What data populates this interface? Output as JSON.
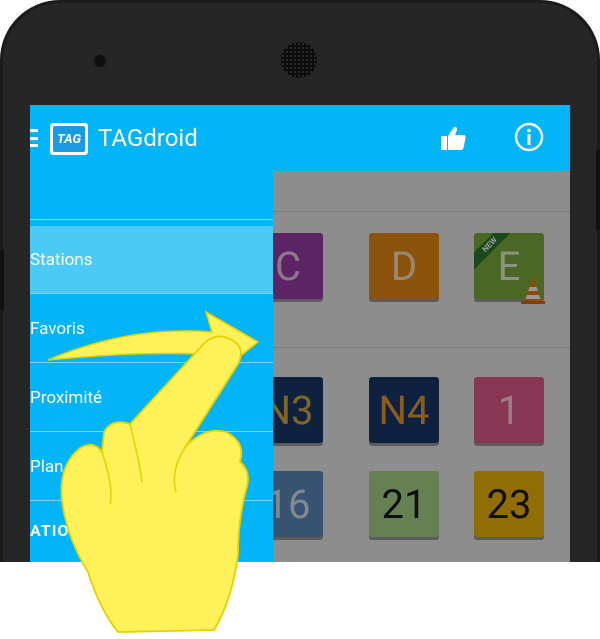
{
  "app": {
    "title": "TAGdroid",
    "logo_text": "TAG"
  },
  "appbar": {
    "icons": [
      "menu-icon",
      "thumbs-up-icon",
      "info-icon"
    ]
  },
  "drawer": {
    "items": [
      {
        "label": "Stations",
        "active": true
      },
      {
        "label": "Favoris",
        "active": false
      },
      {
        "label": "Proximité",
        "active": false
      },
      {
        "label": "Plan",
        "active": false
      }
    ],
    "section_fragment": "ATION"
  },
  "tiles": [
    {
      "label": "C",
      "color": "#9b3da8",
      "text_color": "#e9c7ee"
    },
    {
      "label": "D",
      "color": "#e88a13",
      "text_color": "#fde4c1"
    },
    {
      "label": "E",
      "color": "#7cae3d",
      "text_color": "#e6f3d6",
      "badge": "NEW"
    },
    {
      "label": "N3",
      "color": "#183a6a",
      "text_color": "#d8a93a"
    },
    {
      "label": "N4",
      "color": "#183a6a",
      "text_color": "#e89a3a"
    },
    {
      "label": "1",
      "color": "#e15a8a",
      "text_color": "#f9d2e0"
    },
    {
      "label": "16",
      "color": "#5c8bbb",
      "text_color": "#d8e6f5"
    },
    {
      "label": "21",
      "color": "#a8d78c",
      "text_color": "#1a1a1a"
    },
    {
      "label": "23",
      "color": "#f2b806",
      "text_color": "#1a1a1a"
    }
  ],
  "colors": {
    "appbar": "#03b4f6",
    "drawer": "#03b4f6",
    "drawer_active": "#4bcaf7",
    "gesture": "#fff15a"
  }
}
